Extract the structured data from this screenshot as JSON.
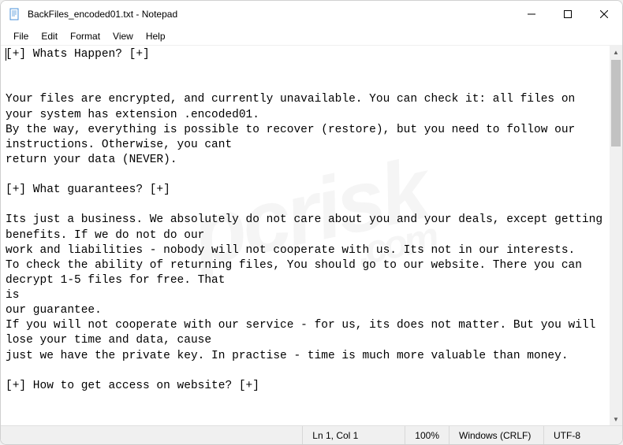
{
  "titlebar": {
    "title": "BackFiles_encoded01.txt - Notepad"
  },
  "menu": {
    "file": "File",
    "edit": "Edit",
    "format": "Format",
    "view": "View",
    "help": "Help"
  },
  "content": "[+] Whats Happen? [+]\n\n\nYour files are encrypted, and currently unavailable. You can check it: all files on your system has extension .encoded01.\nBy the way, everything is possible to recover (restore), but you need to follow our instructions. Otherwise, you cant\nreturn your data (NEVER).\n\n[+] What guarantees? [+]\n\nIts just a business. We absolutely do not care about you and your deals, except getting benefits. If we do not do our\nwork and liabilities - nobody will not cooperate with us. Its not in our interests.\nTo check the ability of returning files, You should go to our website. There you can decrypt 1-5 files for free. That\nis\nour guarantee.\nIf you will not cooperate with our service - for us, its does not matter. But you will lose your time and data, cause\njust we have the private key. In practise - time is much more valuable than money.\n\n[+] How to get access on website? [+]",
  "status": {
    "position": "Ln 1, Col 1",
    "zoom": "100%",
    "lineending": "Windows (CRLF)",
    "encoding": "UTF-8"
  },
  "watermark": {
    "main": "pcrisk",
    "sub": ".com"
  }
}
